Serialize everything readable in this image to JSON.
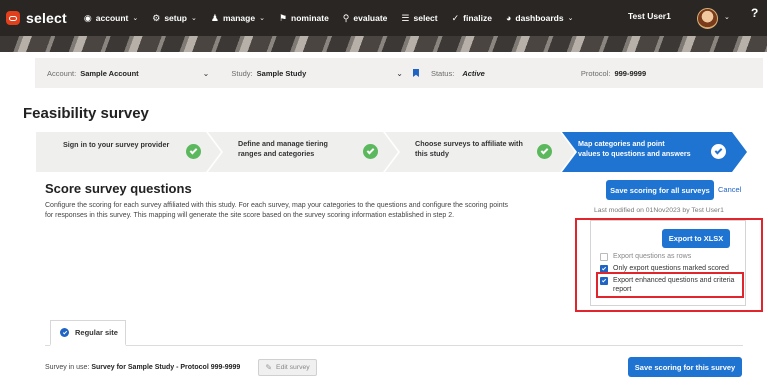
{
  "nav": {
    "logo": "select",
    "items": [
      {
        "label": "account",
        "icon": "globe-icon",
        "glyph": "◉",
        "dropdown": true
      },
      {
        "label": "setup",
        "icon": "gear-icon",
        "glyph": "⚙",
        "dropdown": true
      },
      {
        "label": "manage",
        "icon": "person-icon",
        "glyph": "♟",
        "dropdown": true
      },
      {
        "label": "nominate",
        "icon": "nominate-icon",
        "glyph": "⚑",
        "dropdown": false
      },
      {
        "label": "evaluate",
        "icon": "search-icon",
        "glyph": "⚲",
        "dropdown": false
      },
      {
        "label": "select",
        "icon": "list-icon",
        "glyph": "☰",
        "dropdown": false
      },
      {
        "label": "finalize",
        "icon": "check-circle-icon",
        "glyph": "✓",
        "dropdown": false
      },
      {
        "label": "dashboards",
        "icon": "pie-chart-icon",
        "glyph": "◕",
        "dropdown": true
      }
    ],
    "user": "Test User1",
    "help": "?"
  },
  "account_bar": {
    "account_label": "Account:",
    "account_value": "Sample Account",
    "study_label": "Study:",
    "study_value": "Sample Study",
    "status_label": "Status:",
    "status_value": "Active",
    "protocol_label": "Protocol:",
    "protocol_value": "999-9999"
  },
  "page_title": "Feasibility survey",
  "steps": [
    {
      "line1": "Sign in to your survey provider",
      "line2": "",
      "done": true
    },
    {
      "line1": "Define and manage tiering",
      "line2": "ranges and categories",
      "done": true
    },
    {
      "line1": "Choose surveys to affiliate with",
      "line2": "this study",
      "done": true
    },
    {
      "line1": "Map categories and point",
      "line2": "values to questions and answers",
      "done": true,
      "active": true
    }
  ],
  "score": {
    "title": "Score survey questions",
    "description": "Configure the scoring for each survey affiliated with this study. For each survey, map your categories to the questions and configure the scoring points for responses in this survey. This mapping will generate the site score based on the survey scoring information established in step 2.",
    "save_all": "Save scoring for all surveys",
    "cancel": "Cancel",
    "last_modified": "Last modified on 01Nov2023 by Test User1"
  },
  "export": {
    "button": "Export to XLSX",
    "options": [
      {
        "label": "Export questions as rows",
        "checked": false,
        "disabled": true
      },
      {
        "label": "Only export questions marked scored",
        "checked": true,
        "disabled": false
      },
      {
        "label": "Export enhanced questions and criteria report",
        "checked": true,
        "disabled": false
      }
    ]
  },
  "tab": {
    "label": "Regular site"
  },
  "survey": {
    "prefix": "Survey in use:",
    "name": "Survey for Sample Study - Protocol 999-9999",
    "edit": "Edit survey",
    "save": "Save scoring for this survey"
  },
  "colors": {
    "nav_bg": "#2a2623",
    "accent": "#1f73d1",
    "logo": "#e2401c",
    "done": "#5bb85d",
    "highlight": "#e0262c"
  }
}
